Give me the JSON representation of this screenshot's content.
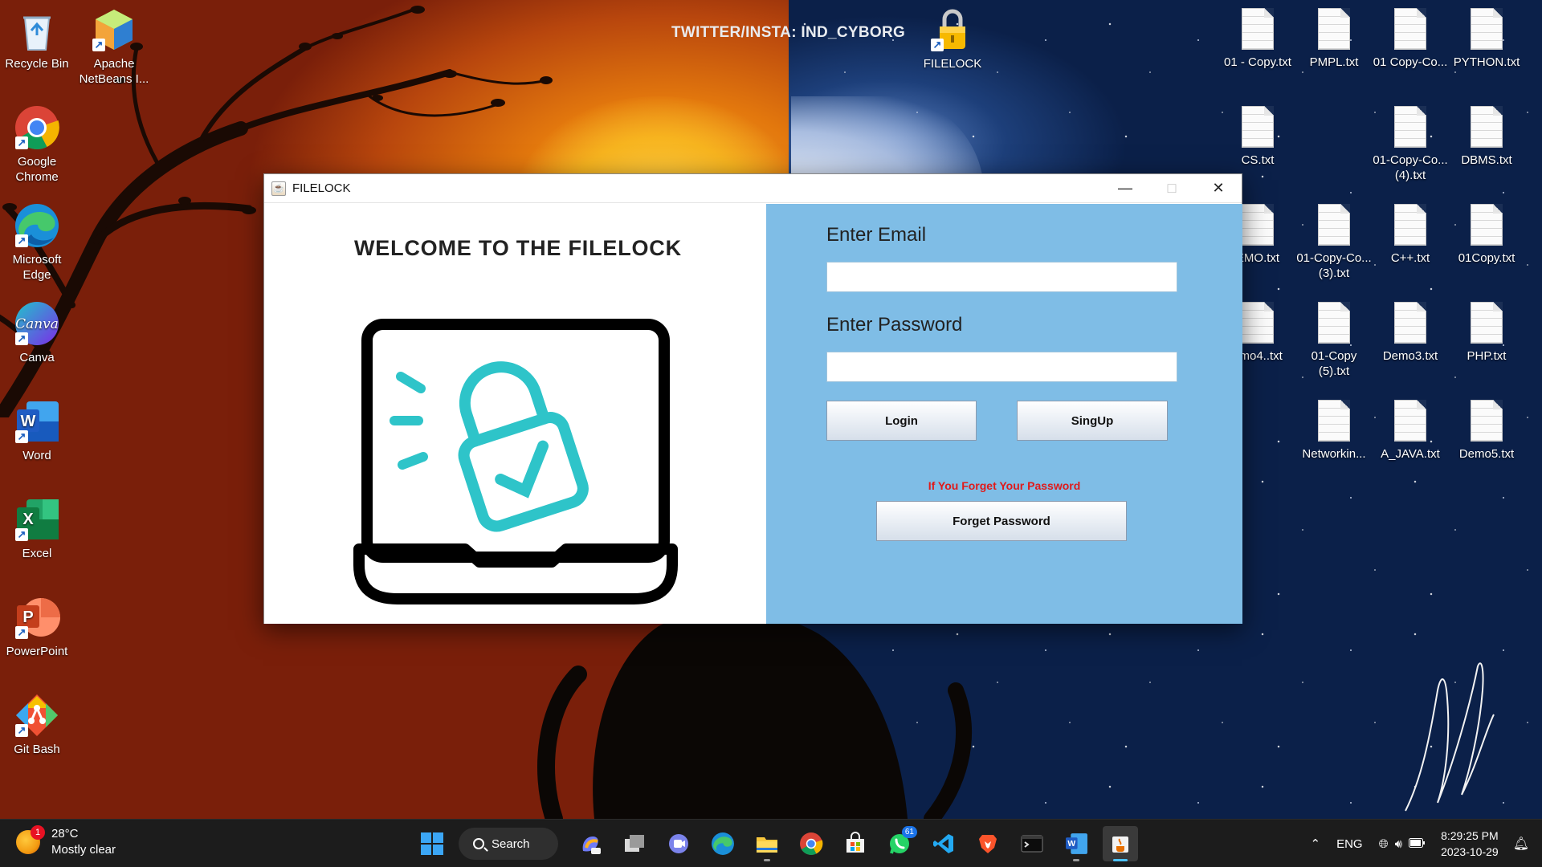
{
  "wallpaper": {
    "watermark": "TWITTER/INSTA: IND_CYBORG"
  },
  "desktop_icons_left": [
    {
      "label": "Recycle Bin",
      "icon": "recycle-bin-icon"
    },
    {
      "label": "Apache NetBeans I...",
      "icon": "netbeans-icon"
    },
    {
      "label": "Google Chrome",
      "icon": "chrome-icon"
    },
    {
      "label": "Microsoft Edge",
      "icon": "edge-icon"
    },
    {
      "label": "Canva",
      "icon": "canva-icon"
    },
    {
      "label": "Word",
      "icon": "word-icon"
    },
    {
      "label": "Excel",
      "icon": "excel-icon"
    },
    {
      "label": "PowerPoint",
      "icon": "powerpoint-icon"
    },
    {
      "label": "Git Bash",
      "icon": "git-bash-icon"
    }
  ],
  "desktop_icon_filelock": {
    "label": "FILELOCK",
    "icon": "padlock-icon"
  },
  "desktop_files": [
    "01 - Copy.txt",
    "PMPL.txt",
    "01 Copy-Co...",
    "PYTHON.txt",
    "CS.txt",
    "01-Copy-Co... (4).txt",
    "DBMS.txt",
    "EMO.txt",
    "01-Copy-Co... (3).txt",
    "C++.txt",
    "01Copy.txt",
    "emo4..txt",
    "01-Copy (5).txt",
    "Demo3.txt",
    "PHP.txt",
    "Networkin...",
    "A_JAVA.txt",
    "Demo5.txt"
  ],
  "window": {
    "title": "FILELOCK",
    "welcome": "WELCOME TO THE FILELOCK",
    "email_label": "Enter Email",
    "email_value": "",
    "password_label": "Enter Password",
    "password_value": "",
    "login_button": "Login",
    "signup_button": "SingUp",
    "forgot_note": "If You Forget Your Password",
    "forgot_button": "Forget Password",
    "accent_color": "#7fbde6",
    "note_color": "#e01a1a"
  },
  "taskbar": {
    "weather_temp": "28°C",
    "weather_desc": "Mostly clear",
    "weather_badge": "1",
    "search_label": "Search",
    "whatsapp_badge": "61",
    "language": "ENG",
    "time": "8:29:25 PM",
    "date": "2023-10-29"
  }
}
